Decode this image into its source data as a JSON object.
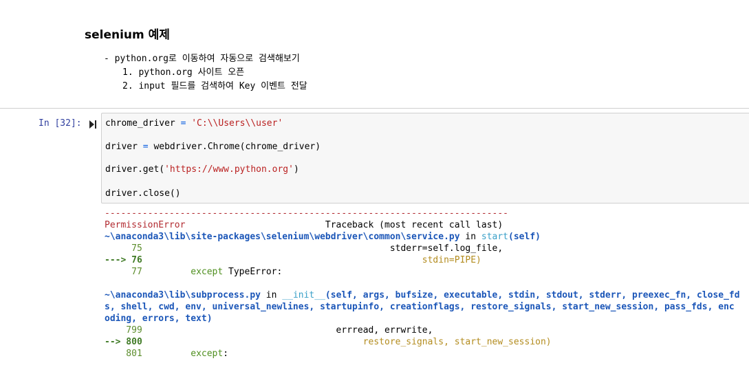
{
  "markdown": {
    "title": "selenium 예제",
    "bullet": "- python.org로 이동하여 자동으로 검색해보기",
    "items": [
      "1. python.org 사이트 오픈",
      "2. input 필드를 검색하여 Key 이벤트 전달"
    ]
  },
  "cell": {
    "prompt": "In [32]:",
    "code": {
      "l1_var": "chrome_driver",
      "l1_op": " = ",
      "l1_str": "'C:\\\\Users\\\\user'",
      "l2_var": "driver",
      "l2_op": " = ",
      "l2_rest": "webdriver.Chrome(chrome_driver)",
      "l3_a": "driver.get(",
      "l3_str": "'https://www.python.org'",
      "l3_b": ")",
      "l4": "driver.close()"
    }
  },
  "output": {
    "dashes": "---------------------------------------------------------------------------",
    "error_name": "PermissionError",
    "traceback_label": "                          Traceback (most recent call last)",
    "tb1_path": "~\\anaconda3\\lib\\site-packages\\selenium\\webdriver\\common\\service.py",
    "tb1_in": " in ",
    "tb1_func": "start",
    "tb1_args": "(self)",
    "l75_num": "     75",
    "l75_code": "                                              stderr=self.log_file,",
    "l76_arrow": "---> 76",
    "l76_code": "                                                    stdin=PIPE)",
    "l77_num": "     77",
    "l77_kw": "         except",
    "l77_code": " TypeError:",
    "tb2_path": "~\\anaconda3\\lib\\subprocess.py",
    "tb2_in": " in ",
    "tb2_func": "__init__",
    "tb2_args1": "(self, args, bufsize, executable, stdin, stdout, stderr, preexec_fn, close_fd",
    "tb2_args2": "s, shell, cwd, env, universal_newlines, startupinfo, creationflags, restore_signals, start_new_session, pass_fds, enc",
    "tb2_args3": "oding, errors, text)",
    "l799_num": "    799",
    "l799_code": "                                    errread, errwrite,",
    "l800_arrow": "--> 800",
    "l800_code": "                                         restore_signals, start_new_session)",
    "l801_num": "    801",
    "l801_kw": "         except",
    "l801_code": ":"
  }
}
